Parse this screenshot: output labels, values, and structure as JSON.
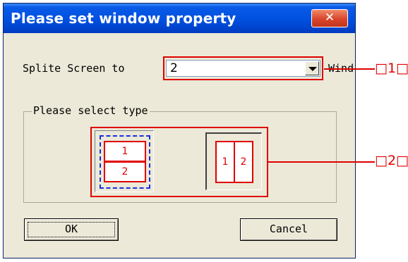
{
  "window": {
    "title": "Please set window property",
    "close_glyph": "✕"
  },
  "split": {
    "label": "Splite Screen to",
    "value": "2",
    "suffix": "Window"
  },
  "group": {
    "legend": "Please select type",
    "types": [
      {
        "panes": [
          "1",
          "2"
        ],
        "orientation": "horizontal",
        "selected": true
      },
      {
        "panes": [
          "1",
          "2"
        ],
        "orientation": "vertical",
        "selected": false
      }
    ]
  },
  "buttons": {
    "ok": "OK",
    "cancel": "Cancel"
  },
  "callouts": {
    "c1": "□1□",
    "c2": "□2□"
  },
  "colors": {
    "accent": "#e00000",
    "selection": "#1a2ee0",
    "titlebar": "#0050e0"
  }
}
